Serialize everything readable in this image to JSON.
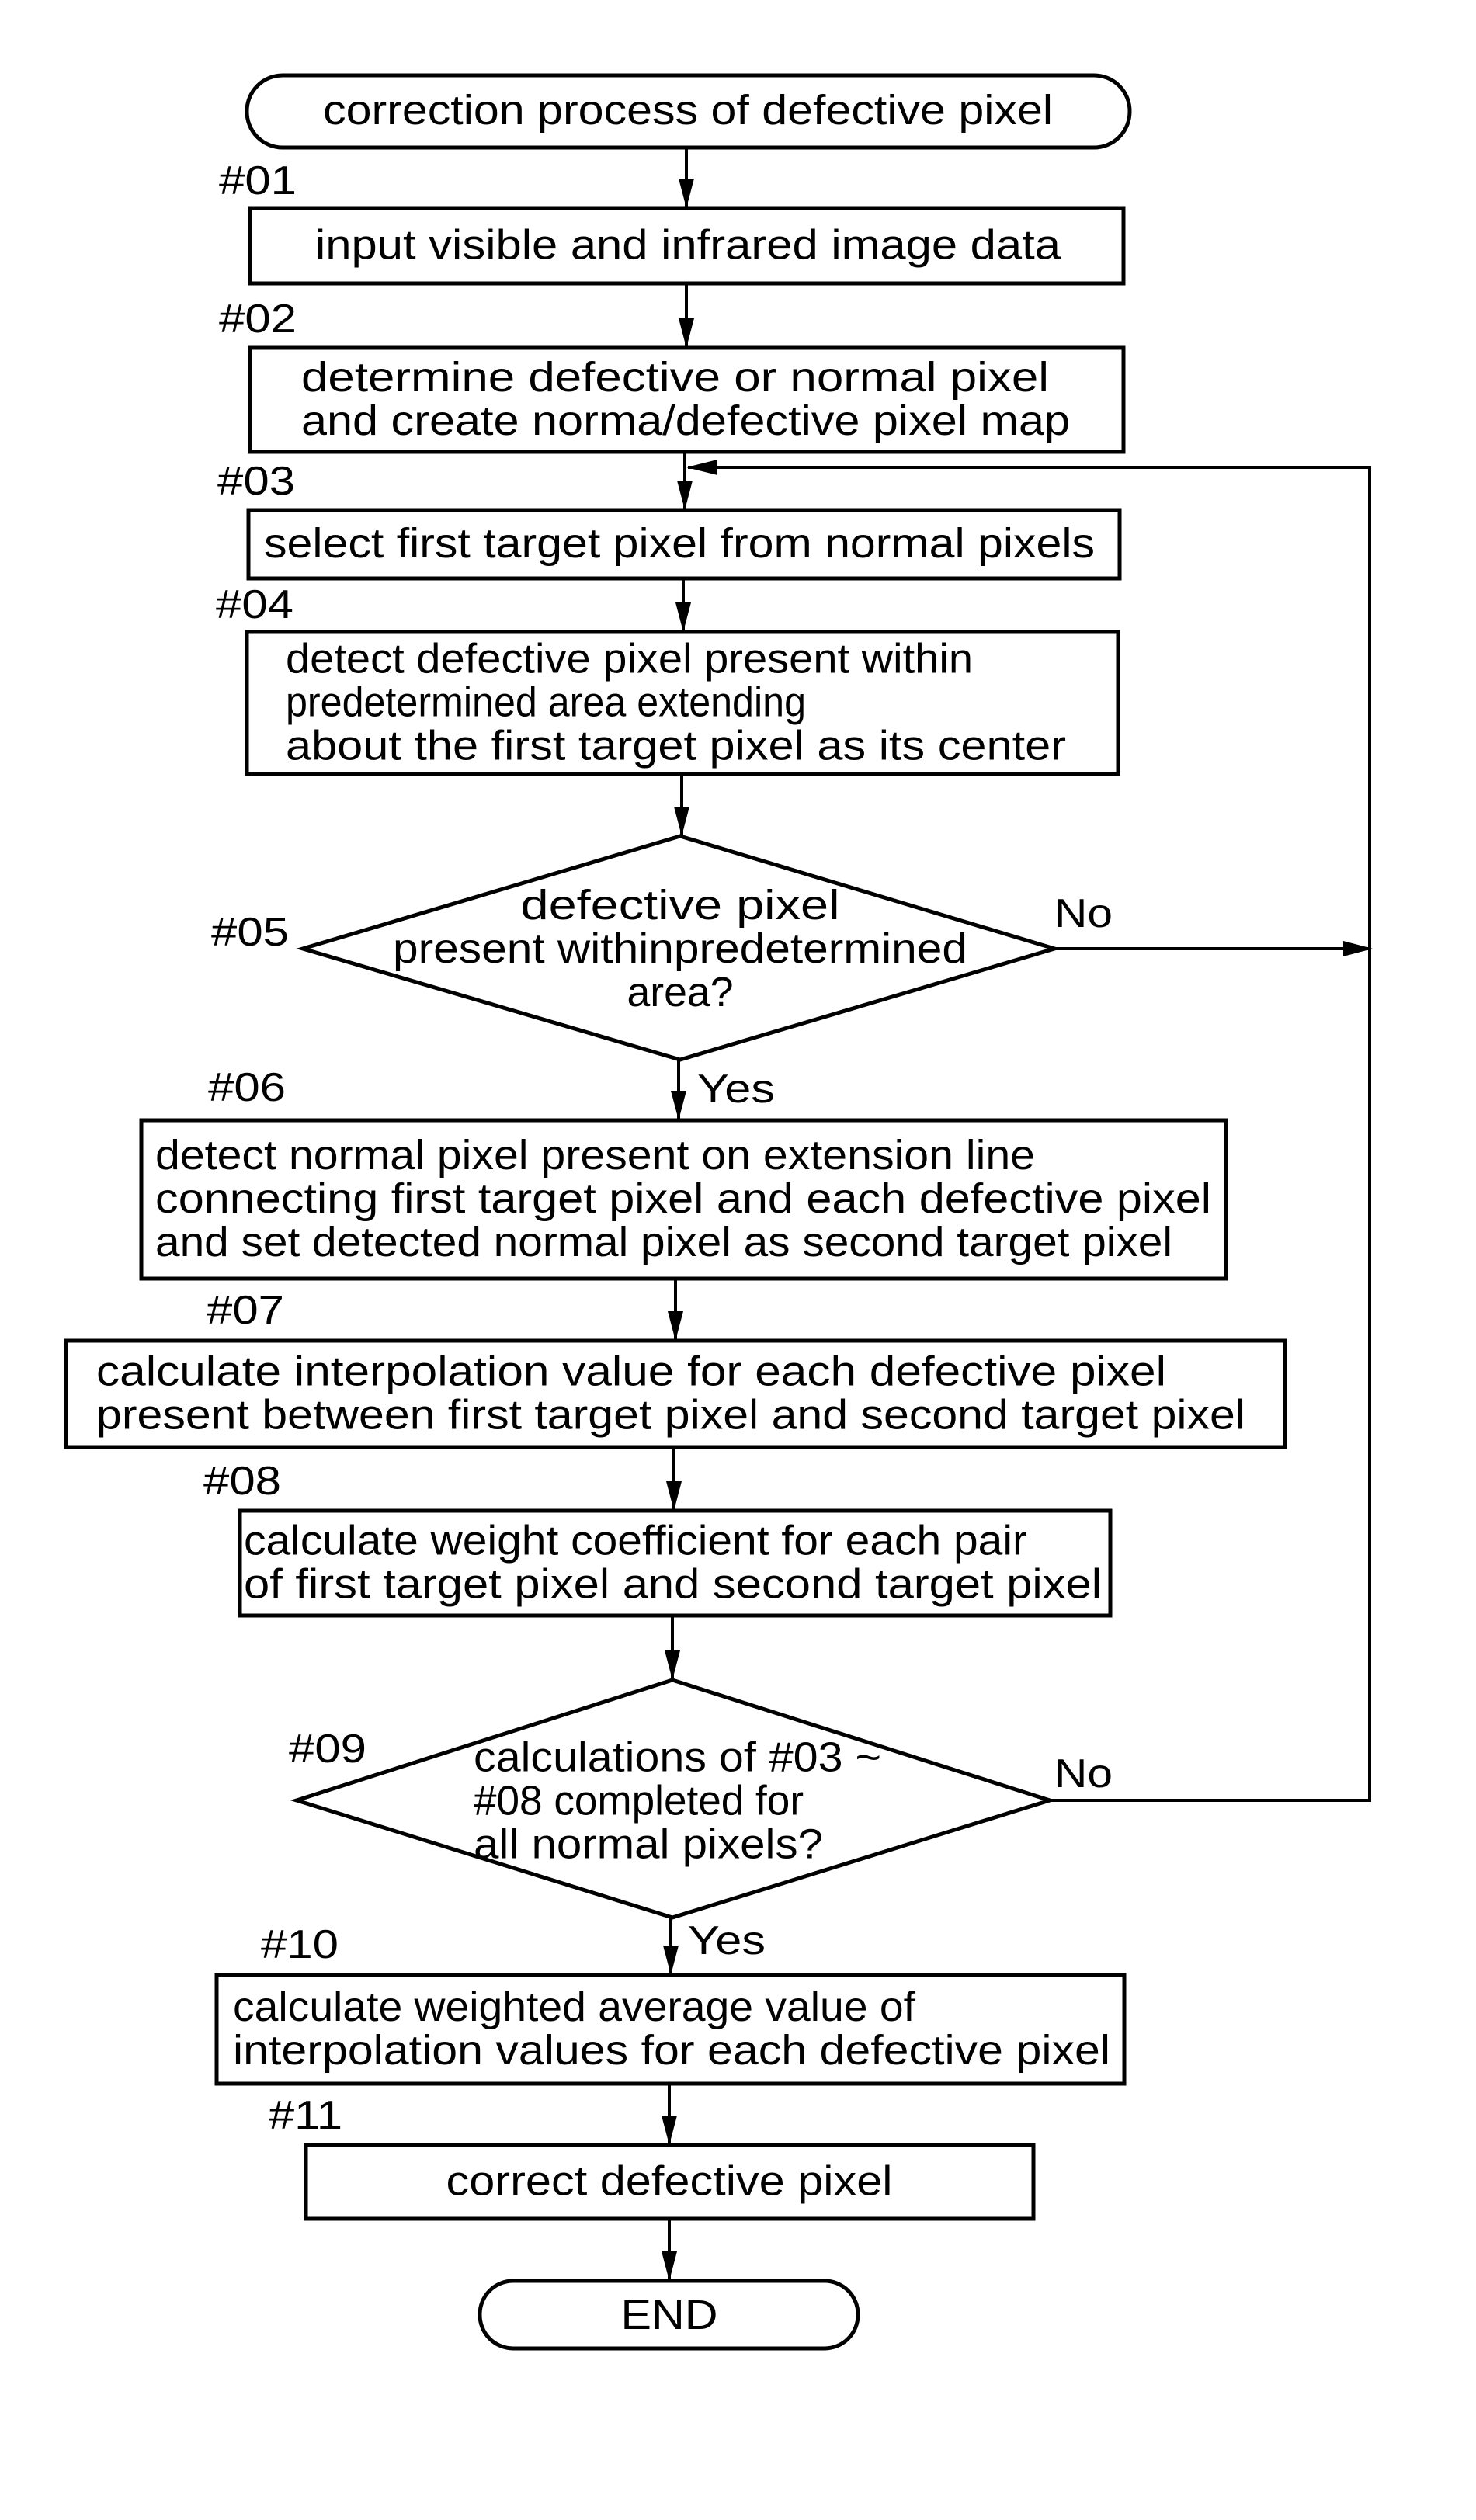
{
  "diagram": {
    "type": "flowchart",
    "start": {
      "label": "correction process of defective pixel"
    },
    "end": {
      "label": "END"
    },
    "steps": [
      {
        "id": "#01",
        "kind": "process",
        "lines": [
          "input visible and infrared image data"
        ]
      },
      {
        "id": "#02",
        "kind": "process",
        "lines": [
          "determine defective or normal pixel",
          "and create norma/defective pixel map"
        ]
      },
      {
        "id": "#03",
        "kind": "process",
        "lines": [
          "select first target pixel from normal pixels"
        ]
      },
      {
        "id": "#04",
        "kind": "process",
        "lines": [
          "detect defective pixel present within",
          "predetermined area extending",
          "about the first target pixel as its center"
        ]
      },
      {
        "id": "#05",
        "kind": "decision",
        "lines": [
          "defective pixel",
          "present withinpredetermined",
          "area?"
        ],
        "yes_label": "Yes",
        "no_label": "No"
      },
      {
        "id": "#06",
        "kind": "process",
        "lines": [
          "detect normal pixel present on extension line",
          "connecting first target pixel and each defective pixel",
          "and set detected normal pixel as second target pixel"
        ]
      },
      {
        "id": "#07",
        "kind": "process",
        "lines": [
          "calculate interpolation value for each defective pixel",
          "present between first target pixel and second target pixel"
        ]
      },
      {
        "id": "#08",
        "kind": "process",
        "lines": [
          "calculate weight coefficient for each pair",
          "of first target  pixel and second target pixel"
        ]
      },
      {
        "id": "#09",
        "kind": "decision",
        "lines": [
          "calculations of #03 ~",
          "#08 completed for",
          "all normal pixels?"
        ],
        "yes_label": "Yes",
        "no_label": "No"
      },
      {
        "id": "#10",
        "kind": "process",
        "lines": [
          "calculate weighted average value of",
          "interpolation values for each defective pixel"
        ]
      },
      {
        "id": "#11",
        "kind": "process",
        "lines": [
          "correct defective pixel"
        ]
      }
    ],
    "edges": [
      {
        "from": "start",
        "to": "#01"
      },
      {
        "from": "#01",
        "to": "#02"
      },
      {
        "from": "#02",
        "to": "#03"
      },
      {
        "from": "#03",
        "to": "#04"
      },
      {
        "from": "#04",
        "to": "#05"
      },
      {
        "from": "#05",
        "to": "#06",
        "label": "Yes"
      },
      {
        "from": "#05",
        "to": "#03",
        "label": "No"
      },
      {
        "from": "#06",
        "to": "#07"
      },
      {
        "from": "#07",
        "to": "#08"
      },
      {
        "from": "#08",
        "to": "#09"
      },
      {
        "from": "#09",
        "to": "#10",
        "label": "Yes"
      },
      {
        "from": "#09",
        "to": "#03",
        "label": "No"
      },
      {
        "from": "#10",
        "to": "#11"
      },
      {
        "from": "#11",
        "to": "end"
      }
    ]
  }
}
